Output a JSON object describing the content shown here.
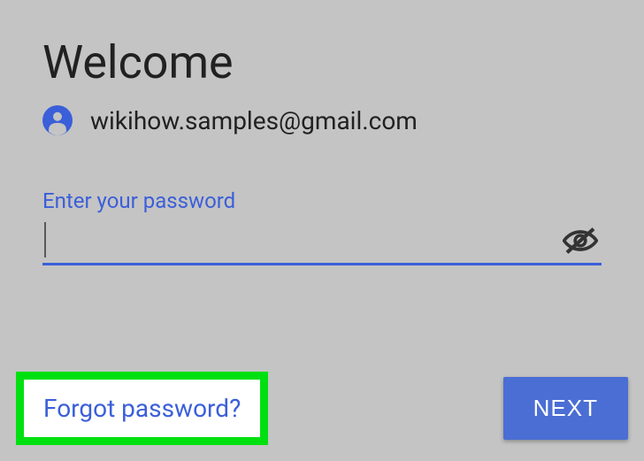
{
  "title": "Welcome",
  "account": {
    "email": "wikihow.samples@gmail.com"
  },
  "password": {
    "label": "Enter your password",
    "value": ""
  },
  "forgot_label": "Forgot password?",
  "next_label": "NEXT"
}
